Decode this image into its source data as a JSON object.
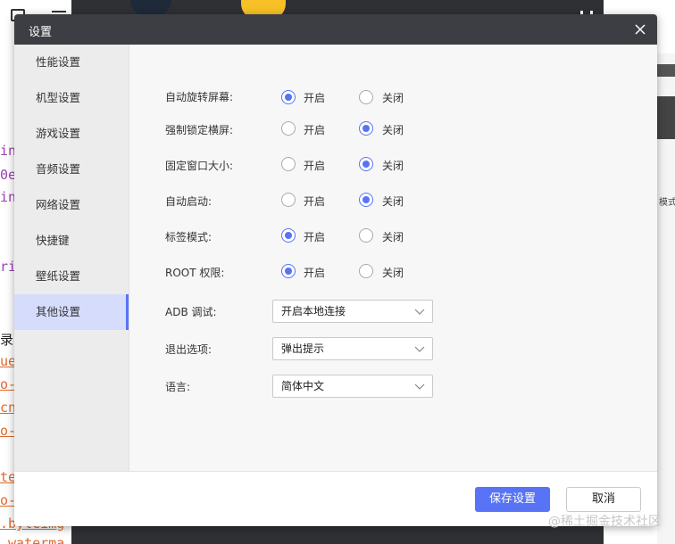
{
  "dialog": {
    "title": "设置",
    "close_icon": "close-icon"
  },
  "sidebar": {
    "items": [
      {
        "label": "性能设置",
        "active": false
      },
      {
        "label": "机型设置",
        "active": false
      },
      {
        "label": "游戏设置",
        "active": false
      },
      {
        "label": "音频设置",
        "active": false
      },
      {
        "label": "网络设置",
        "active": false
      },
      {
        "label": "快捷键",
        "active": false
      },
      {
        "label": "壁纸设置",
        "active": false
      },
      {
        "label": "其他设置",
        "active": true
      }
    ]
  },
  "settings": {
    "on_label": "开启",
    "off_label": "关闭",
    "toggles": [
      {
        "label": "自动旋转屏幕:",
        "value": "on"
      },
      {
        "label": "强制锁定横屏:",
        "value": "off"
      },
      {
        "label": "固定窗口大小:",
        "value": "off"
      },
      {
        "label": "自动启动:",
        "value": "off"
      },
      {
        "label": "标签模式:",
        "value": "on"
      },
      {
        "label": "ROOT 权限:",
        "value": "on"
      }
    ],
    "selects": [
      {
        "label": "ADB 调试:",
        "value": "开启本地连接"
      },
      {
        "label": "退出选项:",
        "value": "弹出提示"
      },
      {
        "label": "语言:",
        "value": "简体中文"
      }
    ]
  },
  "footer": {
    "save_label": "保存设置",
    "cancel_label": "取消"
  },
  "background": {
    "code_lines": [
      "in",
      "0e",
      "in",
      "ri",
      "录",
      "ue",
      "o-v",
      "cn",
      "o-v",
      "te",
      "o-v",
      ".byteimg",
      ".waterma"
    ],
    "right_text": "模式:",
    "watermark": "@稀土掘金技术社区"
  },
  "colors": {
    "accent": "#5873f5",
    "header_bg": "#3c3e44",
    "sidebar_active_bg": "#d6ddfc"
  }
}
